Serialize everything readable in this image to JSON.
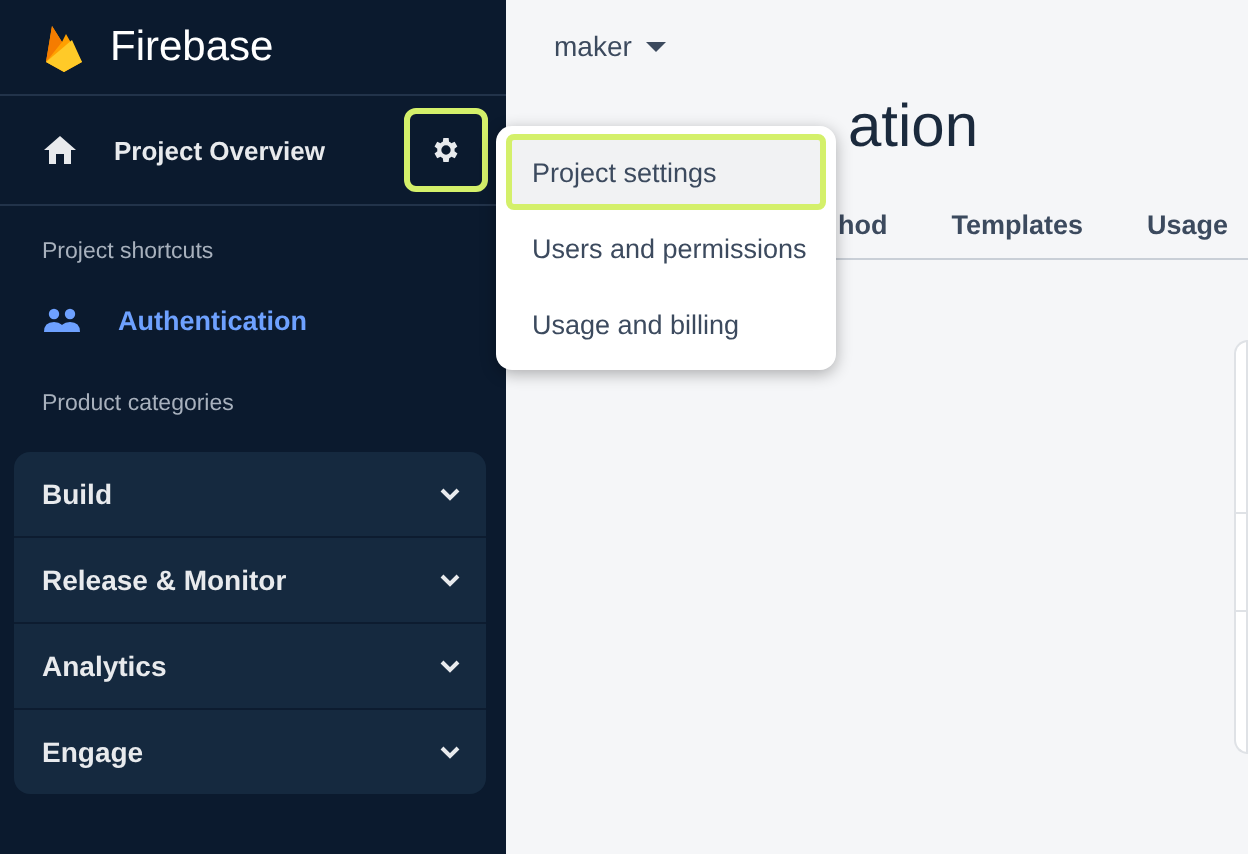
{
  "sidebar": {
    "brand": "Firebase",
    "overview": {
      "label": "Project Overview",
      "settings_highlighted": true
    },
    "shortcuts_heading": "Project shortcuts",
    "shortcuts": [
      {
        "label": "Authentication",
        "selected": true
      }
    ],
    "categories_heading": "Product categories",
    "categories": [
      {
        "label": "Build",
        "expanded": false
      },
      {
        "label": "Release & Monitor",
        "expanded": false
      },
      {
        "label": "Analytics",
        "expanded": false
      },
      {
        "label": "Engage",
        "expanded": false
      }
    ]
  },
  "header": {
    "project": "maker",
    "title": "ation"
  },
  "tabs": [
    {
      "label": "hod",
      "selected": false
    },
    {
      "label": "Templates",
      "selected": false
    },
    {
      "label": "Usage",
      "selected": false
    }
  ],
  "settings_menu": [
    {
      "label": "Project settings",
      "highlighted": true
    },
    {
      "label": "Users and permissions",
      "highlighted": false
    },
    {
      "label": "Usage and billing",
      "highlighted": false
    }
  ]
}
